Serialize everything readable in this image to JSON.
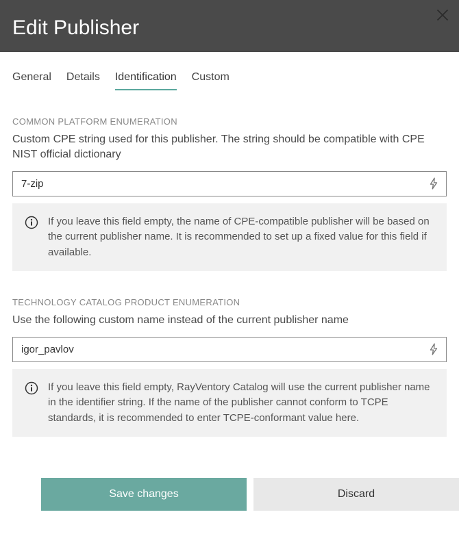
{
  "header": {
    "title": "Edit Publisher"
  },
  "tabs": {
    "general": "General",
    "details": "Details",
    "identification": "Identification",
    "custom": "Custom",
    "active": "identification"
  },
  "cpe": {
    "label": "COMMON PLATFORM ENUMERATION",
    "desc": "Custom CPE string used for this publisher. The string should be compatible with CPE NIST official dictionary",
    "value": "7-zip",
    "info": "If you leave this field empty, the name of CPE-compatible publisher will be based on the current publisher name. It is recommended to set up a fixed value for this field if available."
  },
  "tcpe": {
    "label": "TECHNOLOGY CATALOG PRODUCT ENUMERATION",
    "desc": "Use the following custom name instead of the current publisher name",
    "value": "igor_pavlov",
    "info": "If you leave this field empty, RayVentory Catalog will use the current publisher name in the identifier string. If the name of the publisher cannot conform to TCPE standards, it is recommended to enter TCPE-conformant value here."
  },
  "footer": {
    "save": "Save changes",
    "discard": "Discard"
  }
}
